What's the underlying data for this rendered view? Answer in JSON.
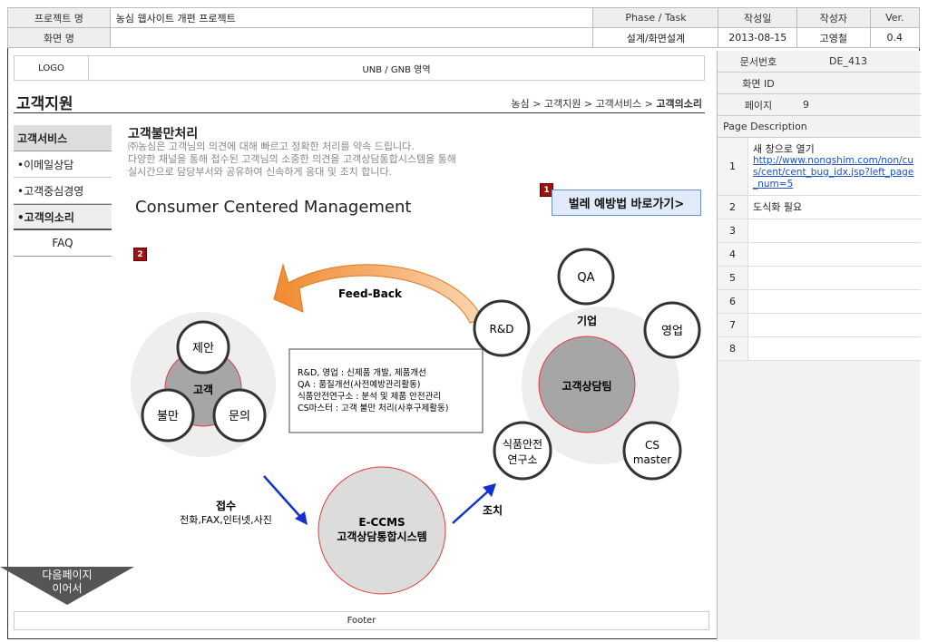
{
  "header": {
    "project_label": "프로젝트 명",
    "project_value": "농심 웹사이트 개편 프로젝트",
    "screen_label": "화면 명",
    "screen_value": "",
    "phase_label": "Phase / Task",
    "phase_value": "설계/화면설계",
    "date_label": "작성일",
    "date_value": "2013-08-15",
    "author_label": "작성자",
    "author_value": "고영철",
    "ver_label": "Ver.",
    "ver_value": "0.4"
  },
  "doc_info": {
    "doc_no_label": "문서번호",
    "doc_no_value": "DE_413",
    "screen_id_label": "화면 ID",
    "screen_id_value": "",
    "page_label": "페이지",
    "page_value": "9"
  },
  "page_description": {
    "title": "Page Description",
    "rows": [
      {
        "num": "1",
        "text": "새 창으로 열기",
        "link": "http://www.nongshim.com/non/cus/cent/cent_bug_idx.jsp?left_page_num=5"
      },
      {
        "num": "2",
        "text": "도식화 필요",
        "link": ""
      },
      {
        "num": "3",
        "text": "",
        "link": ""
      },
      {
        "num": "4",
        "text": "",
        "link": ""
      },
      {
        "num": "5",
        "text": "",
        "link": ""
      },
      {
        "num": "6",
        "text": "",
        "link": ""
      },
      {
        "num": "7",
        "text": "",
        "link": ""
      },
      {
        "num": "8",
        "text": "",
        "link": ""
      }
    ]
  },
  "top_bar": {
    "logo": "LOGO",
    "unb": "UNB / GNB 영역"
  },
  "page_title": "고객지원",
  "breadcrumb": {
    "c1": "농심",
    "sep": ">",
    "c2": "고객지원",
    "c3": "고객서비스",
    "c4": "고객의소리"
  },
  "side_nav": {
    "header": "고객서비스",
    "items": [
      "•이메일상담",
      "•고객중심경영",
      "•고객의소리",
      "FAQ"
    ]
  },
  "section": {
    "title": "고객불만처리",
    "desc1": "㈜농심은 고객님의 의견에 대해 빠르고 정확한 처리를 약속 드립니다.",
    "desc2": "다양한 채널을 통해 접수된 고객님의 소중한 의견을 고객상담통합시스템을 통해",
    "desc3": "실시간으로 담당부서와 공유하여 신속하게 응대 및 조치 합니다."
  },
  "ccm_title": "Consumer Centered Management",
  "bug_button": "벌레 예방법 바로가기>",
  "badges": {
    "b1": "1",
    "b2": "2"
  },
  "diagram": {
    "feedback": "Feed-Back",
    "customer": "고객",
    "c_suggest": "제안",
    "c_complaint": "불만",
    "c_inquiry": "문의",
    "company": "기업",
    "team": "고객상담팀",
    "qa": "QA",
    "rnd": "R&D",
    "sales": "영업",
    "lab1": "식품안전",
    "lab2": "연구소",
    "cs1": "CS",
    "cs2": "master",
    "note1": "R&D, 영업 : 신제품 개발, 제품개선",
    "note2": "QA : 품질개선(사전예방관리활동)",
    "note3": "식품안전연구소 : 분석 및 제품 안전관리",
    "note4": "CS마스터 : 고객 불만 처리(사후구제활동)",
    "receive": "접수",
    "channels": "전화,FAX,인터넷,사진",
    "system1": "E-CCMS",
    "system2": "고객상담통합시스템",
    "action": "조치"
  },
  "next_page": {
    "l1": "다음페이지",
    "l2": "이어서"
  },
  "footer": "Footer"
}
